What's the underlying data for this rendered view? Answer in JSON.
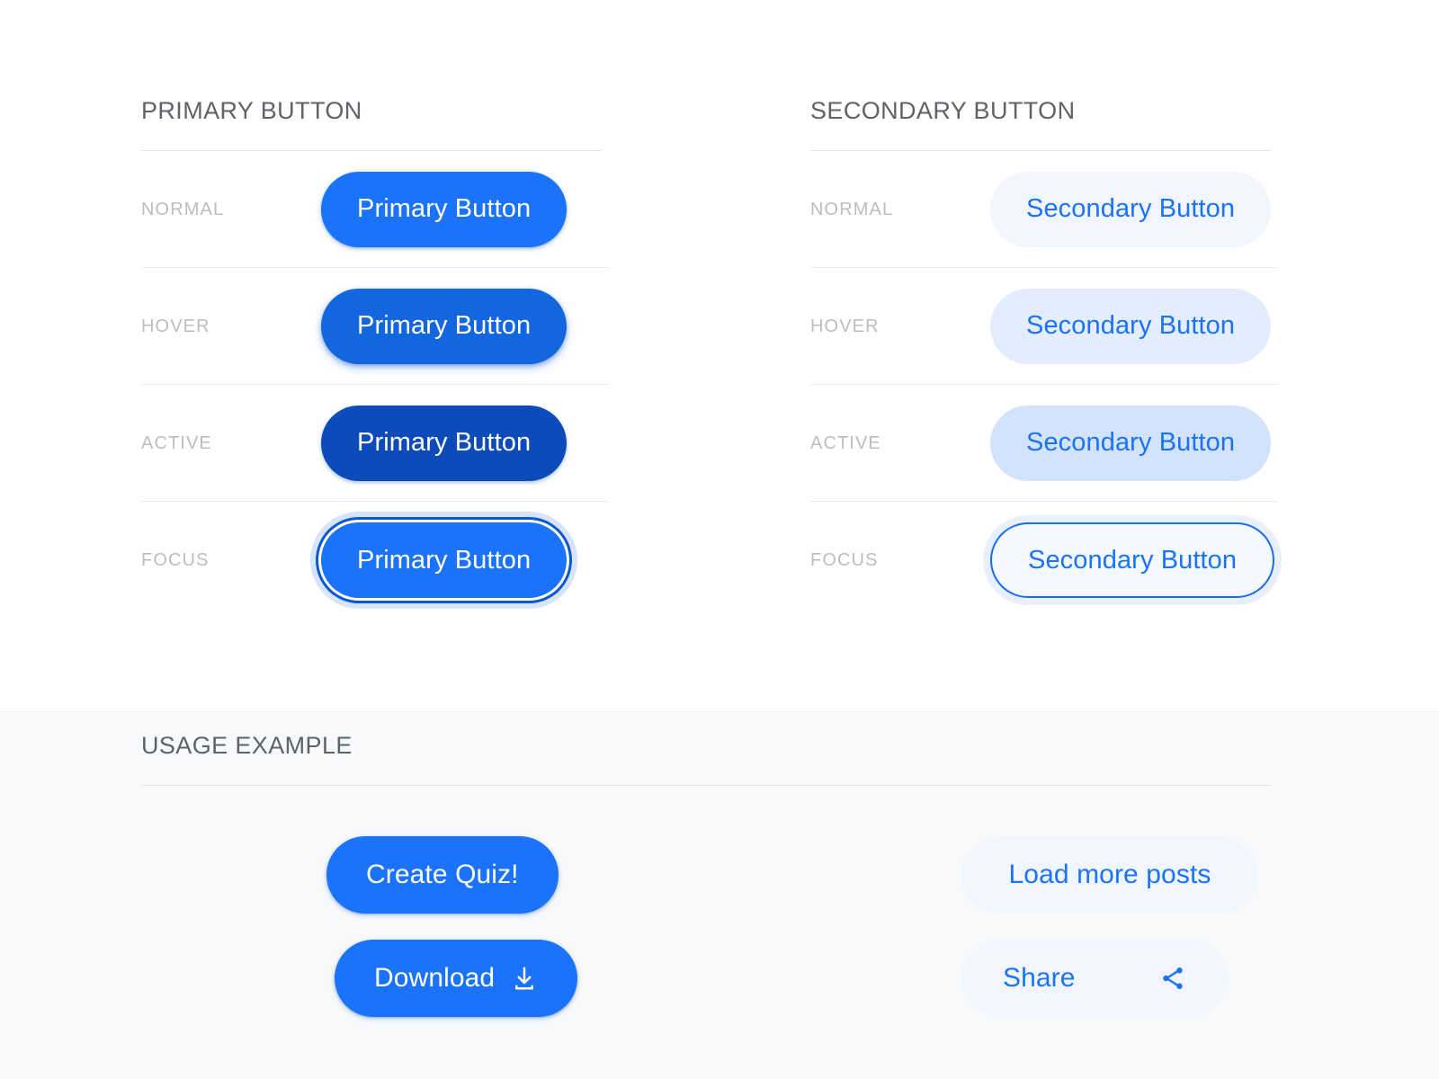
{
  "theme": {
    "primary": "#1a73f8",
    "primary_hover": "#1266e0",
    "primary_active": "#0b4cba",
    "primary_focus_ring": "#0b57d0",
    "secondary_bg": "#f1f5fe",
    "secondary_hover_bg": "#e4edfd",
    "secondary_active_bg": "#d3e3fd",
    "secondary_text": "#1a73f8",
    "label_gray": "#bdbdbd",
    "title_gray": "#5f6368",
    "rule_gray": "#e3e3e3",
    "usage_band_bg": "#f8f9fa",
    "page_bg": "#ffffff"
  },
  "primary_section": {
    "title": "PRIMARY BUTTON",
    "rows": [
      {
        "state": "NORMAL",
        "label": "Primary Button"
      },
      {
        "state": "HOVER",
        "label": "Primary Button"
      },
      {
        "state": "ACTIVE",
        "label": "Primary Button"
      },
      {
        "state": "FOCUS",
        "label": "Primary Button"
      }
    ]
  },
  "secondary_section": {
    "title": "SECONDARY BUTTON",
    "rows": [
      {
        "state": "NORMAL",
        "label": "Secondary Button"
      },
      {
        "state": "HOVER",
        "label": "Secondary Button"
      },
      {
        "state": "ACTIVE",
        "label": "Secondary Button"
      },
      {
        "state": "FOCUS",
        "label": "Secondary Button"
      }
    ]
  },
  "usage_section": {
    "title": "USAGE EXAMPLE",
    "buttons": {
      "create_quiz": {
        "label": "Create Quiz!"
      },
      "download": {
        "label": "Download",
        "icon": "download-icon"
      },
      "load_more": {
        "label": "Load more posts"
      },
      "share": {
        "label": "Share",
        "icon": "share-icon"
      }
    }
  }
}
